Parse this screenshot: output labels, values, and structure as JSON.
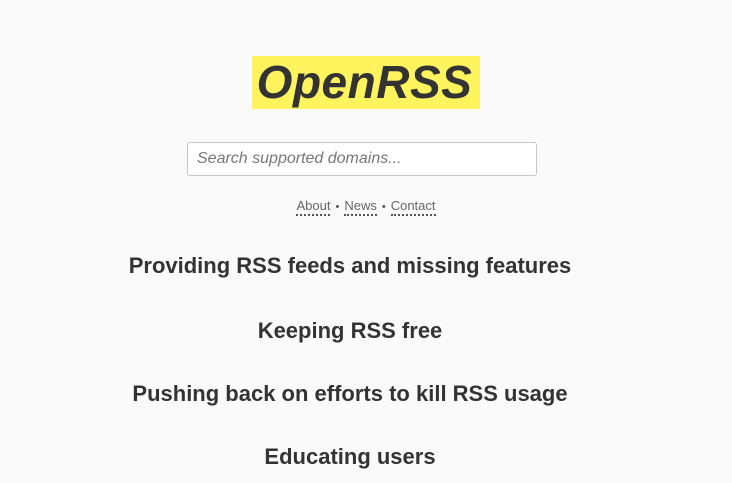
{
  "logo": {
    "text": "OpenRSS",
    "highlight_color": "#fff35e"
  },
  "search": {
    "value": "",
    "placeholder": "Search supported domains..."
  },
  "nav": {
    "links": [
      "About",
      "News",
      "Contact"
    ],
    "separator": "•"
  },
  "headlines": [
    "Providing RSS feeds and missing features",
    "Keeping RSS free",
    "Pushing back on efforts to kill RSS usage",
    "Educating users"
  ]
}
